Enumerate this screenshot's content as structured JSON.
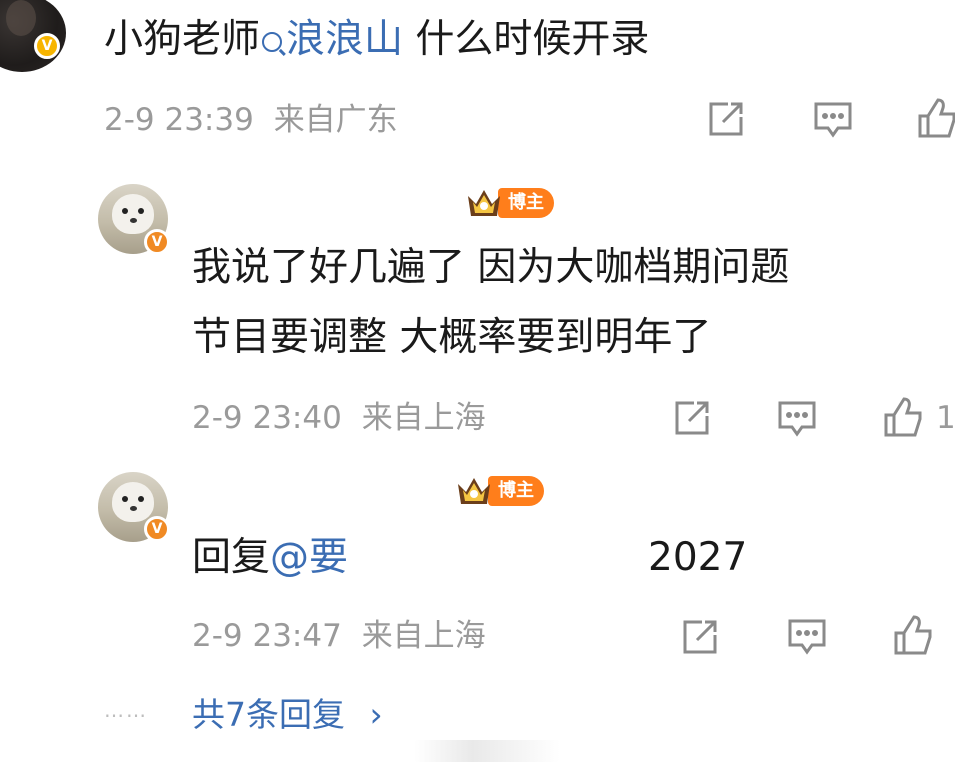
{
  "top_comment": {
    "author": "小狗老师",
    "topic": "浪浪山",
    "text": " 什么时候开录",
    "time": "2-9 23:39",
    "location": "来自广东",
    "verified_badge": "V"
  },
  "replies": [
    {
      "role_badge": "博主",
      "text_line1": "我说了好几遍了 因为大咖档期问题",
      "text_line2": "节目要调整 大概率要到明年了",
      "time": "2-9 23:40",
      "location": "来自上海",
      "like_count": "1",
      "verified_badge": "V"
    },
    {
      "role_badge": "博主",
      "reply_prefix": "回复",
      "mention": "@要",
      "text_tail": "2027",
      "time": "2-9 23:47",
      "location": "来自上海",
      "verified_badge": "V"
    }
  ],
  "more_replies": {
    "dots": "……",
    "label": "共7条回复",
    "arrow": "›"
  },
  "icons": [
    "share-icon",
    "comment-icon",
    "like-icon",
    "search-icon",
    "crown-icon"
  ],
  "colors": {
    "link": "#3b6db3",
    "meta": "#9a9a9a",
    "badge_orange": "#ff7e1b",
    "verified_yellow": "#f7b500"
  }
}
